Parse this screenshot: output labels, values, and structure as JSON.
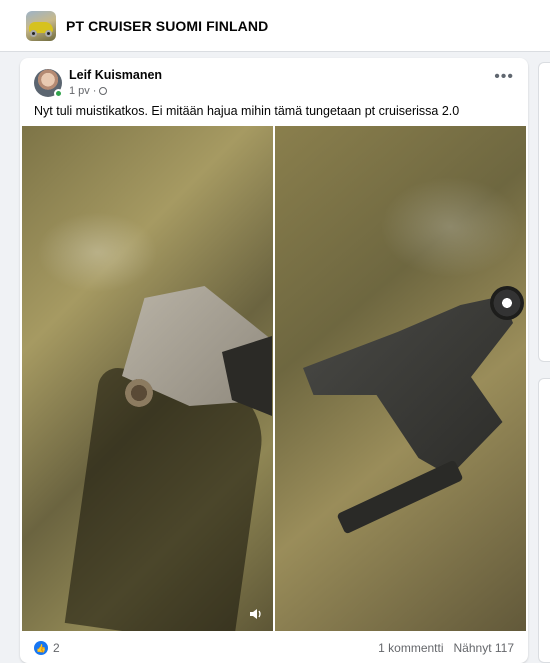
{
  "group": {
    "name": "PT CRUISER SUOMI FINLAND"
  },
  "post": {
    "author": "Leif Kuismanen",
    "time": "1 pv",
    "separator": "·",
    "more_label": "•••",
    "text": "Nyt tuli muistikatkos. Ei mitään hajua mihin tämä tungetaan pt cruiserissa 2.0",
    "images": [
      {
        "icon": "car-part-photo-left"
      },
      {
        "icon": "car-part-photo-right"
      }
    ]
  },
  "footer": {
    "reaction_icon": "like-icon",
    "reaction_count": "2",
    "comments": "1 kommentti",
    "views": "Nähnyt 117"
  },
  "colors": {
    "accent": "#1877f2",
    "online": "#31a24c",
    "background": "#f0f2f5"
  }
}
